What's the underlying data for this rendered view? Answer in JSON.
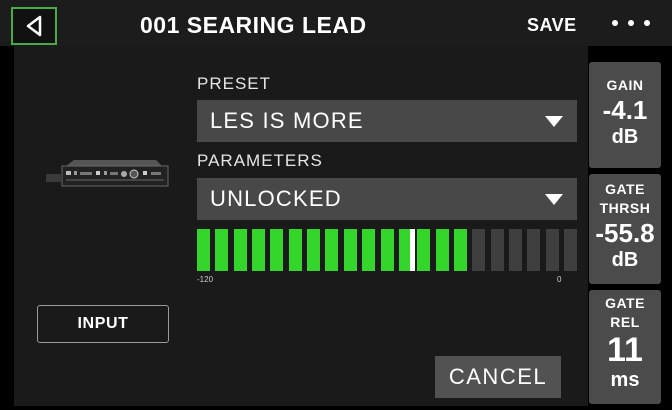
{
  "header": {
    "title": "001 SEARING LEAD",
    "save_label": "SAVE",
    "back_icon": "back-arrow-icon",
    "more_icon": "more-dots-icon"
  },
  "main": {
    "preset_label": "PRESET",
    "preset_value": "LES IS MORE",
    "parameters_label": "PARAMETERS",
    "parameters_value": "UNLOCKED",
    "meter": {
      "min_label": "-120",
      "max_label": "0",
      "active_color": "#35d62c",
      "inactive_color": "#3f3f3f",
      "lit_segments": 15,
      "total_segments": 21,
      "marker_position": 0.56
    },
    "input_label": "INPUT",
    "cancel_label": "CANCEL"
  },
  "params": [
    {
      "label": "GAIN",
      "value": "-4.1",
      "unit": "dB"
    },
    {
      "label": "GATE THRSH",
      "value": "-55.8",
      "unit": "dB"
    },
    {
      "label": "GATE REL",
      "value": "11",
      "unit": "ms"
    }
  ]
}
